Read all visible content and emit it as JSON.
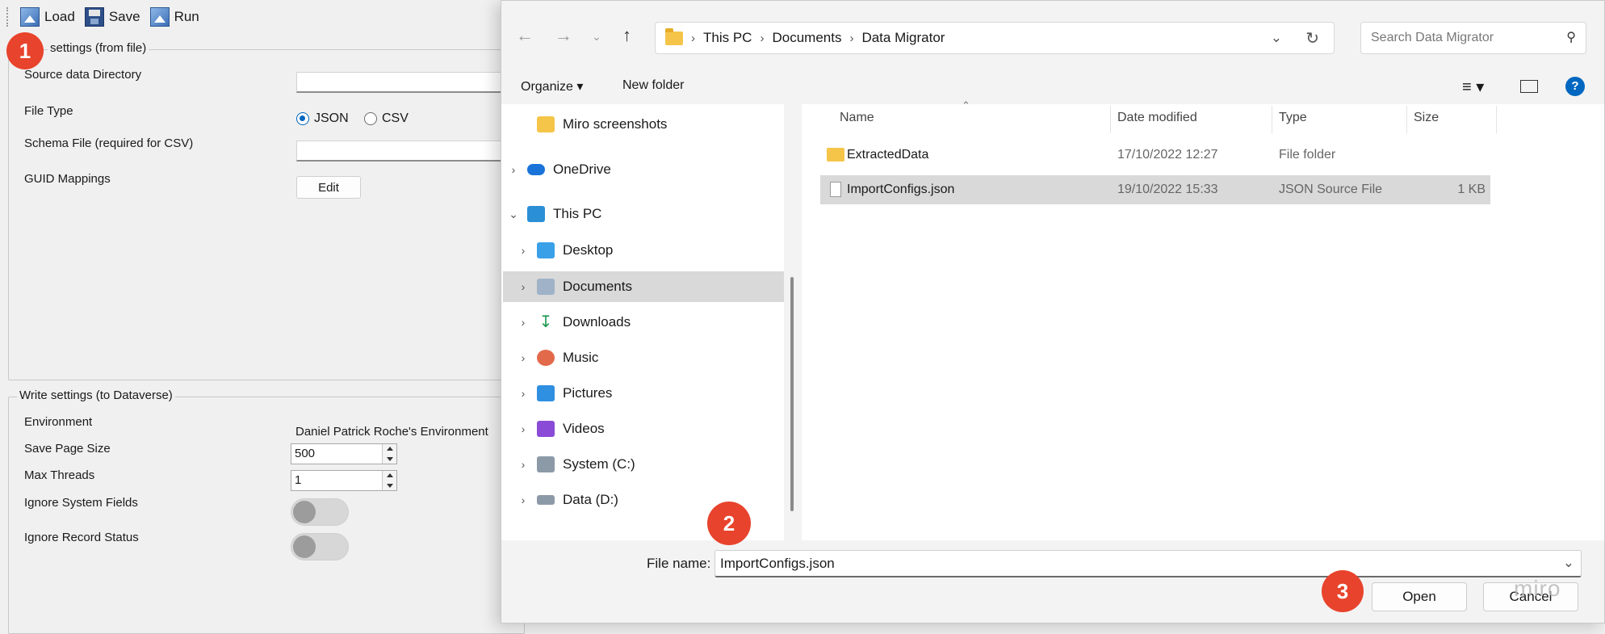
{
  "toolbar": {
    "load": "Load",
    "save": "Save",
    "run": "Run"
  },
  "read_settings": {
    "title": "settings (from file)",
    "source_dir_label": "Source data Directory",
    "file_type_label": "File Type",
    "file_type_options": [
      "JSON",
      "CSV"
    ],
    "file_type_selected": "JSON",
    "schema_label": "Schema File (required for CSV)",
    "guid_label": "GUID Mappings",
    "edit_button": "Edit"
  },
  "write_settings": {
    "title": "Write settings (to Dataverse)",
    "environment_label": "Environment",
    "environment_value": "Daniel Patrick Roche's Environment",
    "page_size_label": "Save Page Size",
    "page_size_value": "500",
    "max_threads_label": "Max Threads",
    "max_threads_value": "1",
    "ignore_system_label": "Ignore System Fields",
    "ignore_status_label": "Ignore Record Status"
  },
  "badges": [
    "1",
    "2",
    "3"
  ],
  "dialog": {
    "breadcrumb": [
      "This PC",
      "Documents",
      "Data Migrator"
    ],
    "search_placeholder": "Search Data Migrator",
    "organize": "Organize",
    "new_folder": "New folder",
    "nav": [
      {
        "label": "Miro screenshots",
        "icon": "folder-icon"
      },
      {
        "label": "OneDrive",
        "icon": "cloud-icon"
      },
      {
        "label": "This PC",
        "icon": "computer-icon"
      },
      {
        "label": "Desktop",
        "icon": "desktop-icon"
      },
      {
        "label": "Documents",
        "icon": "documents-icon"
      },
      {
        "label": "Downloads",
        "icon": "download-icon"
      },
      {
        "label": "Music",
        "icon": "music-icon"
      },
      {
        "label": "Pictures",
        "icon": "pictures-icon"
      },
      {
        "label": "Videos",
        "icon": "videos-icon"
      },
      {
        "label": "System (C:)",
        "icon": "drive-icon"
      },
      {
        "label": "Data (D:)",
        "icon": "drive-icon"
      }
    ],
    "columns": [
      "Name",
      "Date modified",
      "Type",
      "Size"
    ],
    "files": [
      {
        "name": "ExtractedData",
        "date": "17/10/2022 12:27",
        "type": "File folder",
        "size": ""
      },
      {
        "name": "ImportConfigs.json",
        "date": "19/10/2022 15:33",
        "type": "JSON Source File",
        "size": "1 KB"
      }
    ],
    "file_name_label": "File name:",
    "file_name_value": "ImportConfigs.json",
    "open": "Open",
    "cancel": "Cancel"
  },
  "watermark": "miro",
  "colors": {
    "badge": "#e8432c",
    "accent": "#0067c0",
    "selection": "#d9d9d9"
  }
}
